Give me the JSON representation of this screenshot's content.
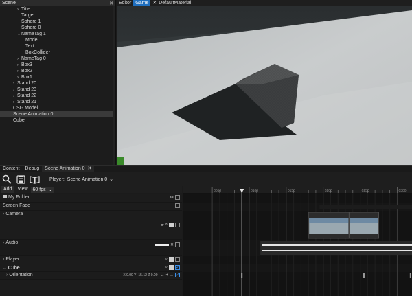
{
  "scene_panel": {
    "title": "Scene",
    "tree": [
      {
        "label": "Title",
        "depth": 3,
        "arrow": "›"
      },
      {
        "label": "Target",
        "depth": 3,
        "arrow": ""
      },
      {
        "label": "Sphere 1",
        "depth": 3,
        "arrow": ""
      },
      {
        "label": "Sphere 0",
        "depth": 3,
        "arrow": ""
      },
      {
        "label": "NameTag 1",
        "depth": 3,
        "arrow": "⌄"
      },
      {
        "label": "Model",
        "depth": 4,
        "arrow": ""
      },
      {
        "label": "Text",
        "depth": 4,
        "arrow": ""
      },
      {
        "label": "BoxCollider",
        "depth": 4,
        "arrow": ""
      },
      {
        "label": "NameTag 0",
        "depth": 3,
        "arrow": "›"
      },
      {
        "label": "Box3",
        "depth": 3,
        "arrow": "›"
      },
      {
        "label": "Box2",
        "depth": 3,
        "arrow": "›"
      },
      {
        "label": "Box1",
        "depth": 3,
        "arrow": "›"
      },
      {
        "label": "Stand 20",
        "depth": 2,
        "arrow": "›"
      },
      {
        "label": "Stand 23",
        "depth": 2,
        "arrow": "›"
      },
      {
        "label": "Stand 22",
        "depth": 2,
        "arrow": "›"
      },
      {
        "label": "Stand 21",
        "depth": 2,
        "arrow": "›"
      },
      {
        "label": "CSG Model",
        "depth": 1,
        "arrow": ""
      },
      {
        "label": "Scene Animation 0",
        "depth": 1,
        "arrow": "",
        "selected": true
      },
      {
        "label": "Cube",
        "depth": 1,
        "arrow": ""
      }
    ]
  },
  "view_tabs": [
    {
      "label": "Editor",
      "active": false
    },
    {
      "label": "Game",
      "active": true
    },
    {
      "label": "DefaultMaterial",
      "active": false,
      "closable": true
    }
  ],
  "bottom_tabs": [
    {
      "label": "Content",
      "active": false
    },
    {
      "label": "Debug",
      "active": false
    },
    {
      "label": "Scene Animation 0",
      "active": true,
      "closable": true
    }
  ],
  "anim_toolbar": {
    "icons": [
      "search-icon",
      "save-icon",
      "book-icon"
    ],
    "player_label": "Player:",
    "player_value": "Scene Animation 0"
  },
  "anim_subbar": {
    "add_label": "Add",
    "view_label": "View",
    "fps_value": "60 fps"
  },
  "tracks": [
    {
      "id": "my-folder",
      "name": "My Folder",
      "icon": "folder-icon"
    },
    {
      "id": "screen-fade",
      "name": "Screen Fade"
    },
    {
      "id": "camera",
      "name": "Camera"
    },
    {
      "id": "audio",
      "name": "Audio"
    },
    {
      "id": "player",
      "name": "Player"
    },
    {
      "id": "cube",
      "name": "Cube"
    },
    {
      "id": "orientation",
      "name": "Orientation",
      "readout": "X 0.00 Y -15.12 Z 0.00"
    }
  ],
  "timeline": {
    "ruler_labels": [
      "0050",
      "0100",
      "0150",
      "0200",
      "0250",
      "0300"
    ],
    "playhead_frame": 90,
    "frames_visible": [
      10,
      320
    ],
    "camera_clips": [
      [
        180,
        235
      ],
      [
        235,
        275
      ]
    ],
    "audio_clip": [
      115,
      335
    ],
    "orientation_keyframes": [
      90,
      255,
      318
    ]
  },
  "colors": {
    "accent": "#1f6fbf",
    "check": "#3b8ee6"
  }
}
